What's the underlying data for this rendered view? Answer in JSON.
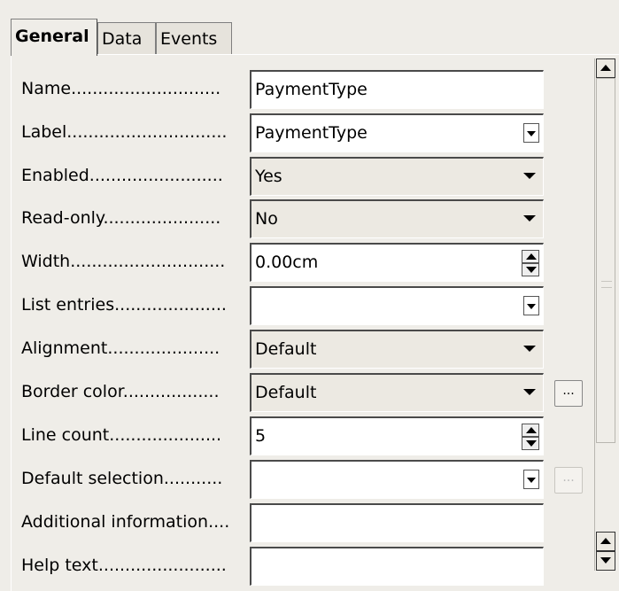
{
  "tabs": [
    {
      "label": "General",
      "active": true
    },
    {
      "label": "Data",
      "active": false
    },
    {
      "label": "Events",
      "active": false
    }
  ],
  "properties": [
    {
      "label": "Name",
      "dots": "............................",
      "value": "PaymentType",
      "control": "text"
    },
    {
      "label": "Label",
      "dots": "..............................",
      "value": "PaymentType",
      "control": "text-dropdown"
    },
    {
      "label": "Enabled",
      "dots": ".........................",
      "value": "Yes",
      "control": "listbox"
    },
    {
      "label": "Read-only",
      "dots": "......................",
      "value": "No",
      "control": "listbox"
    },
    {
      "label": "Width",
      "dots": ".............................",
      "value": "0.00cm",
      "control": "spin"
    },
    {
      "label": "List entries",
      "dots": ".....................",
      "value": "",
      "control": "text-dropdown"
    },
    {
      "label": "Alignment",
      "dots": ".....................",
      "value": "Default",
      "control": "listbox"
    },
    {
      "label": "Border color",
      "dots": "..................",
      "value": "Default",
      "control": "listbox",
      "ellipsis": "...",
      "ellipsis_enabled": true
    },
    {
      "label": "Line count",
      "dots": ".....................",
      "value": "5",
      "control": "spin"
    },
    {
      "label": "Default selection",
      "dots": "...........",
      "value": "",
      "control": "text-dropdown",
      "ellipsis": "...",
      "ellipsis_enabled": false
    },
    {
      "label": "Additional information",
      "dots": "....",
      "value": "",
      "control": "text"
    },
    {
      "label": "Help text",
      "dots": "........................",
      "value": "",
      "control": "text"
    }
  ],
  "scrollbar": {
    "icons": [
      "scroll-up-icon",
      "scroll-down-icon"
    ]
  }
}
